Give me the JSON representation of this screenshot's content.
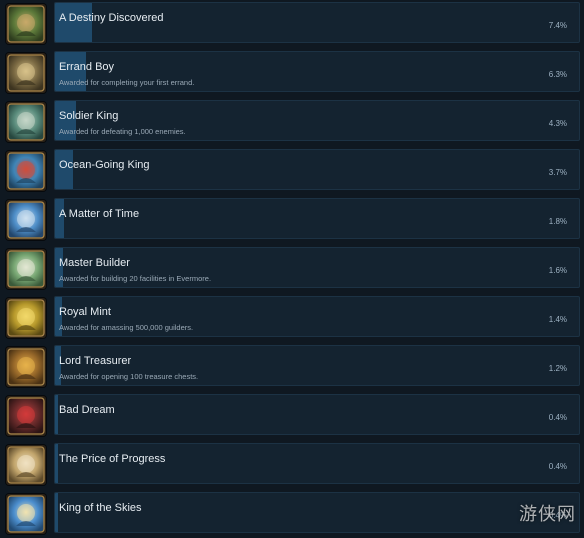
{
  "achievements": [
    {
      "title": "A Destiny Discovered",
      "description": "",
      "percent_label": "7.4%",
      "percent": 7.4,
      "icon": "destiny-icon",
      "icon_colors": [
        "#5d7a3a",
        "#2e3d1e",
        "#c9a96a"
      ]
    },
    {
      "title": "Errand Boy",
      "description": "Awarded for completing your first errand.",
      "percent_label": "6.3%",
      "percent": 6.3,
      "icon": "errand-boy-icon",
      "icon_colors": [
        "#7b6a43",
        "#3d3420",
        "#d8c28a"
      ]
    },
    {
      "title": "Soldier King",
      "description": "Awarded for defeating 1,000 enemies.",
      "percent_label": "4.3%",
      "percent": 4.3,
      "icon": "soldier-king-icon",
      "icon_colors": [
        "#5a8c7c",
        "#27473f",
        "#c6d7c9"
      ]
    },
    {
      "title": "Ocean-Going King",
      "description": "",
      "percent_label": "3.7%",
      "percent": 3.7,
      "icon": "ocean-king-icon",
      "icon_colors": [
        "#3f86b8",
        "#1f4461",
        "#d24c3a"
      ]
    },
    {
      "title": "A Matter of Time",
      "description": "",
      "percent_label": "1.8%",
      "percent": 1.8,
      "icon": "matter-of-time-icon",
      "icon_colors": [
        "#4e8ec8",
        "#23466b",
        "#cfe1f0"
      ]
    },
    {
      "title": "Master Builder",
      "description": "Awarded for building 20 facilities in Evermore.",
      "percent_label": "1.6%",
      "percent": 1.6,
      "icon": "master-builder-icon",
      "icon_colors": [
        "#79a874",
        "#3a5a3a",
        "#e3e7d4"
      ]
    },
    {
      "title": "Royal Mint",
      "description": "Awarded for amassing 500,000 guilders.",
      "percent_label": "1.4%",
      "percent": 1.4,
      "icon": "royal-mint-icon",
      "icon_colors": [
        "#b89a2c",
        "#5c4b13",
        "#f2d86a"
      ]
    },
    {
      "title": "Lord Treasurer",
      "description": "Awarded for opening 100 treasure chests.",
      "percent_label": "1.2%",
      "percent": 1.2,
      "icon": "lord-treasurer-icon",
      "icon_colors": [
        "#9a6a2a",
        "#4b3214",
        "#e7b24b"
      ]
    },
    {
      "title": "Bad Dream",
      "description": "",
      "percent_label": "0.4%",
      "percent": 0.4,
      "icon": "bad-dream-icon",
      "icon_colors": [
        "#6b2b2b",
        "#2c1414",
        "#d33b3b"
      ]
    },
    {
      "title": "The Price of Progress",
      "description": "",
      "percent_label": "0.4%",
      "percent": 0.4,
      "icon": "price-of-progress-icon",
      "icon_colors": [
        "#c2a56c",
        "#5e4b2b",
        "#f0e2c2"
      ]
    },
    {
      "title": "King of the Skies",
      "description": "",
      "percent_label": "0.4%",
      "percent": 0.4,
      "icon": "king-of-skies-icon",
      "icon_colors": [
        "#4c8fcf",
        "#224a72",
        "#f2e3b0"
      ]
    }
  ],
  "watermark": "游侠网"
}
